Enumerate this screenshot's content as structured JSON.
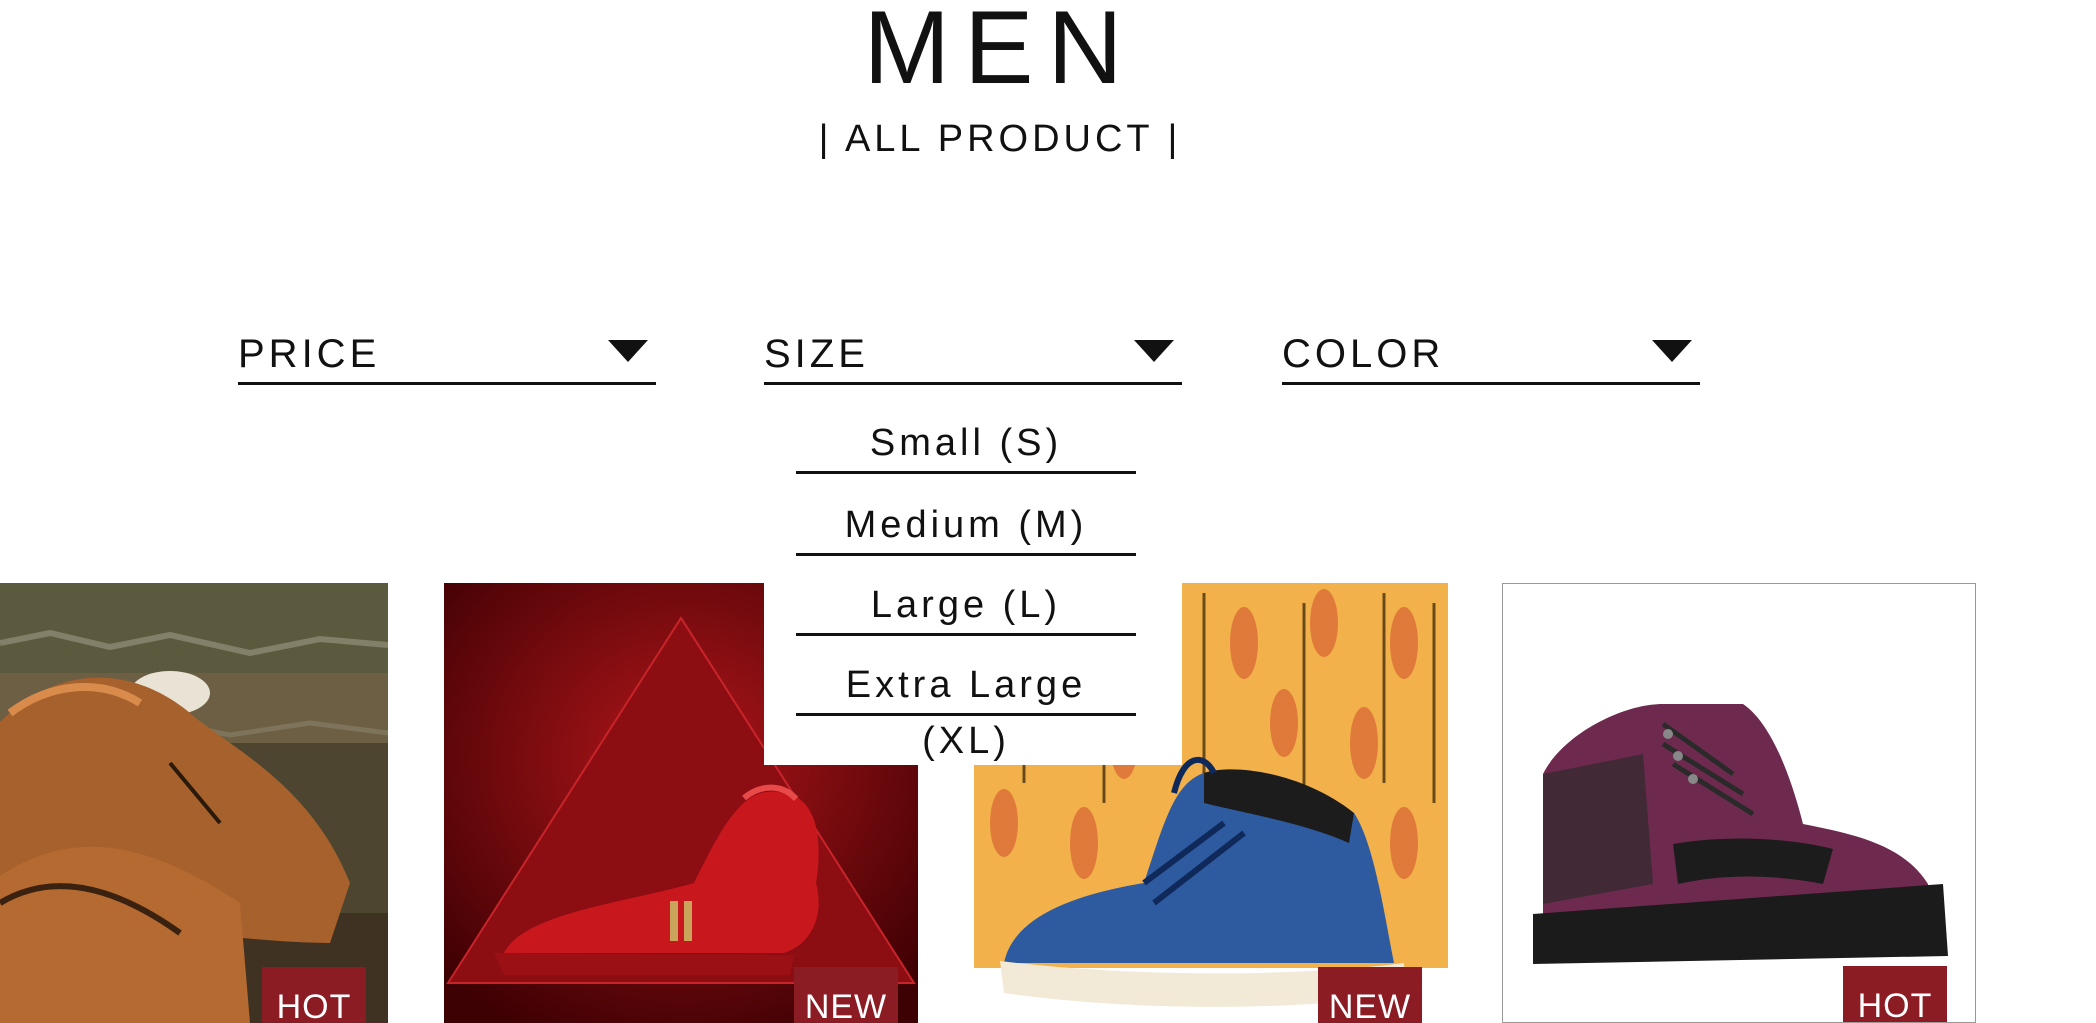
{
  "header": {
    "title": "MEN",
    "subtitle": "| ALL PRODUCT |"
  },
  "filters": [
    {
      "label": "PRICE"
    },
    {
      "label": "SIZE"
    },
    {
      "label": "COLOR"
    }
  ],
  "size_dropdown": {
    "options": [
      "Small (S)",
      "Medium (M)",
      "Large (L)",
      "Extra Large (XL)"
    ]
  },
  "products": [
    {
      "badge": "HOT",
      "image": "brown-leather-brogue-shoes"
    },
    {
      "badge": "NEW",
      "image": "red-high-top-sneaker"
    },
    {
      "badge": "NEW",
      "image": "blue-hiking-boot-autumn-leaves"
    },
    {
      "badge": "HOT",
      "image": "purple-black-hiking-boot"
    }
  ],
  "colors": {
    "badge_bg": "#8b1c24",
    "text": "#111111",
    "background": "#ffffff"
  },
  "icons": {
    "filter_caret": "caret-down-icon"
  }
}
